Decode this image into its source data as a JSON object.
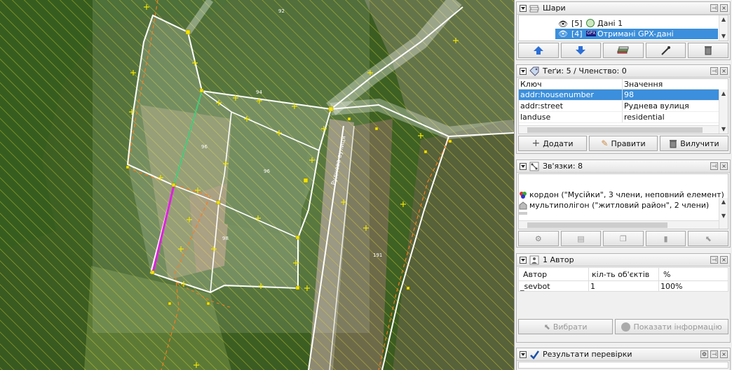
{
  "map": {
    "labels": {
      "l92": "92",
      "l94": "94",
      "l96a": "96",
      "l96b": "96",
      "l98": "98",
      "l191": "191",
      "street": "Руднева вулиця"
    }
  },
  "layers_panel": {
    "title": "Шари",
    "items": [
      {
        "index": "[5]",
        "name": "Дані 1",
        "selected": false
      },
      {
        "index": "[4]",
        "name": "Отримані GPX-дані",
        "selected": true
      }
    ],
    "buttons": [
      "move-up-icon",
      "move-down-icon",
      "merge-icon",
      "visibility-icon",
      "delete-icon"
    ]
  },
  "tags_panel": {
    "title": "Теґи: 5 / Членство: 0",
    "columns": [
      "Ключ",
      "Значення"
    ],
    "rows": [
      {
        "key": "addr:housenumber",
        "value": "98",
        "selected": true
      },
      {
        "key": "addr:street",
        "value": "Руднева вулиця",
        "selected": false
      },
      {
        "key": "landuse",
        "value": "residential",
        "selected": false
      }
    ],
    "buttons": {
      "add": "Додати",
      "edit": "Правити",
      "delete": "Вилучити"
    }
  },
  "relations_panel": {
    "title": "Зв'язки: 8",
    "items": [
      "кордон (\"Мусійки\", 3 члени, неповний елемент)",
      "мультиполігон (\"житловий район\", 2 члени)"
    ]
  },
  "authors_panel": {
    "title": "1 Автор",
    "columns": [
      "Автор",
      "кіл-ть об'єктів",
      "%"
    ],
    "rows": [
      {
        "author": "_sevbot",
        "count": "1",
        "percent": "100%"
      }
    ],
    "buttons": {
      "select": "Вибрати",
      "show_info": "Показати інформацію"
    }
  },
  "validation_panel": {
    "title": "Результати перевірки"
  },
  "colors": {
    "selection": "#3b8fdc",
    "way": "#ffffff",
    "node": "#f2e600",
    "highlight": "#e020e0",
    "boundary": "#ff7a1a"
  }
}
